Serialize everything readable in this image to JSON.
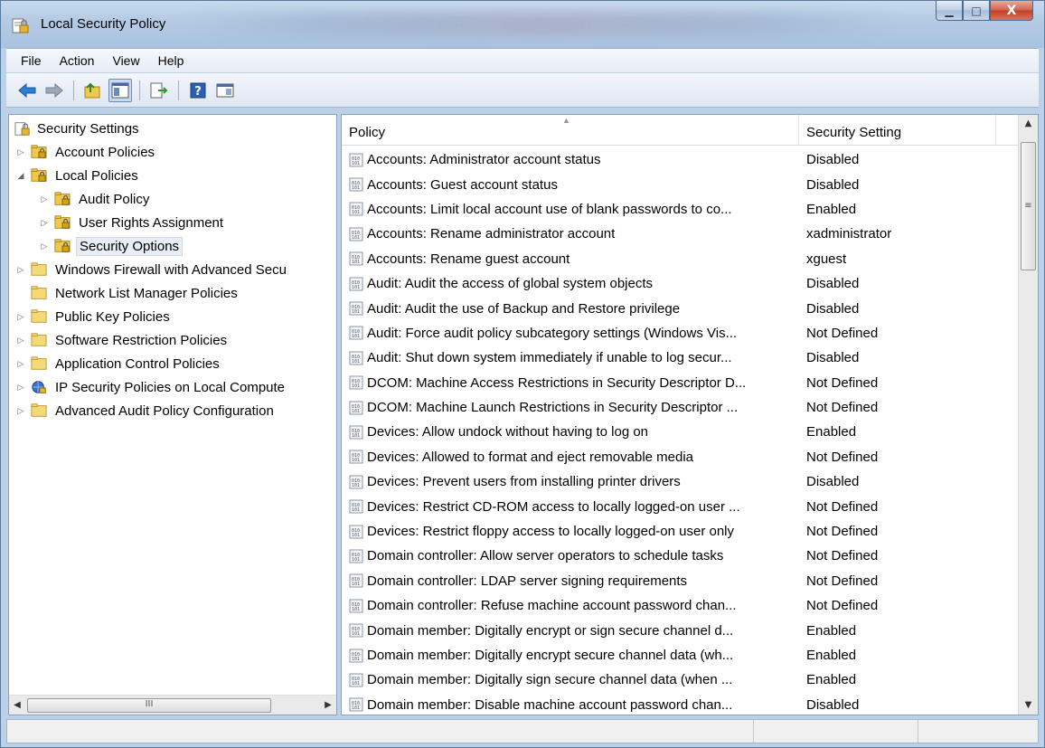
{
  "window": {
    "title": "Local Security Policy",
    "controls": {
      "minimize": "▁",
      "maximize": "□",
      "close": "X"
    }
  },
  "menu": [
    "File",
    "Action",
    "View",
    "Help"
  ],
  "toolbar": [
    "back-icon",
    "forward-icon",
    "up-folder-icon",
    "show-hide-tree-icon",
    "export-list-icon",
    "help-icon",
    "properties-icon"
  ],
  "tree": {
    "root": "Security Settings",
    "items": [
      {
        "label": "Account Policies",
        "arrow": "▷",
        "level": 1
      },
      {
        "label": "Local Policies",
        "arrow": "◢",
        "level": 1
      },
      {
        "label": "Audit Policy",
        "arrow": "▷",
        "level": 2
      },
      {
        "label": "User Rights Assignment",
        "arrow": "▷",
        "level": 2
      },
      {
        "label": "Security Options",
        "arrow": "▷",
        "level": 2,
        "selected": true
      },
      {
        "label": "Windows Firewall with Advanced Secu",
        "arrow": "▷",
        "level": 1
      },
      {
        "label": "Network List Manager Policies",
        "arrow": "",
        "level": 1
      },
      {
        "label": "Public Key Policies",
        "arrow": "▷",
        "level": 1
      },
      {
        "label": "Software Restriction Policies",
        "arrow": "▷",
        "level": 1
      },
      {
        "label": "Application Control Policies",
        "arrow": "▷",
        "level": 1
      },
      {
        "label": "IP Security Policies on Local Compute",
        "arrow": "▷",
        "level": 1
      },
      {
        "label": "Advanced Audit Policy Configuration",
        "arrow": "▷",
        "level": 1
      }
    ],
    "hscroll_thumb": "III"
  },
  "list": {
    "columns": {
      "policy": "Policy",
      "setting": "Security Setting"
    },
    "rows": [
      {
        "policy": "Accounts: Administrator account status",
        "setting": "Disabled"
      },
      {
        "policy": "Accounts: Guest account status",
        "setting": "Disabled"
      },
      {
        "policy": "Accounts: Limit local account use of blank passwords to co...",
        "setting": "Enabled"
      },
      {
        "policy": "Accounts: Rename administrator account",
        "setting": "xadministrator"
      },
      {
        "policy": "Accounts: Rename guest account",
        "setting": "xguest"
      },
      {
        "policy": "Audit: Audit the access of global system objects",
        "setting": "Disabled"
      },
      {
        "policy": "Audit: Audit the use of Backup and Restore privilege",
        "setting": "Disabled"
      },
      {
        "policy": "Audit: Force audit policy subcategory settings (Windows Vis...",
        "setting": "Not Defined"
      },
      {
        "policy": "Audit: Shut down system immediately if unable to log secur...",
        "setting": "Disabled"
      },
      {
        "policy": "DCOM: Machine Access Restrictions in Security Descriptor D...",
        "setting": "Not Defined"
      },
      {
        "policy": "DCOM: Machine Launch Restrictions in Security Descriptor ...",
        "setting": "Not Defined"
      },
      {
        "policy": "Devices: Allow undock without having to log on",
        "setting": "Enabled"
      },
      {
        "policy": "Devices: Allowed to format and eject removable media",
        "setting": "Not Defined"
      },
      {
        "policy": "Devices: Prevent users from installing printer drivers",
        "setting": "Disabled"
      },
      {
        "policy": "Devices: Restrict CD-ROM access to locally logged-on user ...",
        "setting": "Not Defined"
      },
      {
        "policy": "Devices: Restrict floppy access to locally logged-on user only",
        "setting": "Not Defined"
      },
      {
        "policy": "Domain controller: Allow server operators to schedule tasks",
        "setting": "Not Defined"
      },
      {
        "policy": "Domain controller: LDAP server signing requirements",
        "setting": "Not Defined"
      },
      {
        "policy": "Domain controller: Refuse machine account password chan...",
        "setting": "Not Defined"
      },
      {
        "policy": "Domain member: Digitally encrypt or sign secure channel d...",
        "setting": "Enabled"
      },
      {
        "policy": "Domain member: Digitally encrypt secure channel data (wh...",
        "setting": "Enabled"
      },
      {
        "policy": "Domain member: Digitally sign secure channel data (when ...",
        "setting": "Enabled"
      },
      {
        "policy": "Domain member: Disable machine account password chan...",
        "setting": "Disabled"
      }
    ],
    "vscroll_grip": "≡"
  },
  "colors": {
    "folder": "#f0c84a",
    "lock": "#d6a21c",
    "selection": "#e8eef5"
  }
}
